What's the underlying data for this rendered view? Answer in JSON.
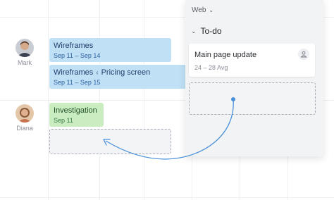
{
  "people": [
    {
      "name": "Mark"
    },
    {
      "name": "Diana"
    }
  ],
  "timeline": {
    "bars": [
      {
        "title": "Wireframes",
        "dates": "Sep 11 – Sep 14"
      },
      {
        "title": "Wireframes",
        "subtitle": "Pricing screen",
        "dates": "Sep 11 – Sep 15"
      },
      {
        "title": "Investigation",
        "dates": "Sep 11"
      }
    ]
  },
  "panel": {
    "filter_label": "Web",
    "section_title": "To-do",
    "task": {
      "title": "Main page update",
      "dates": "24 – 28 Avg"
    }
  },
  "colors": {
    "blue_bar": "#bfe0f5",
    "green_bar": "#c9edc0",
    "arrow": "#4a90d9"
  }
}
